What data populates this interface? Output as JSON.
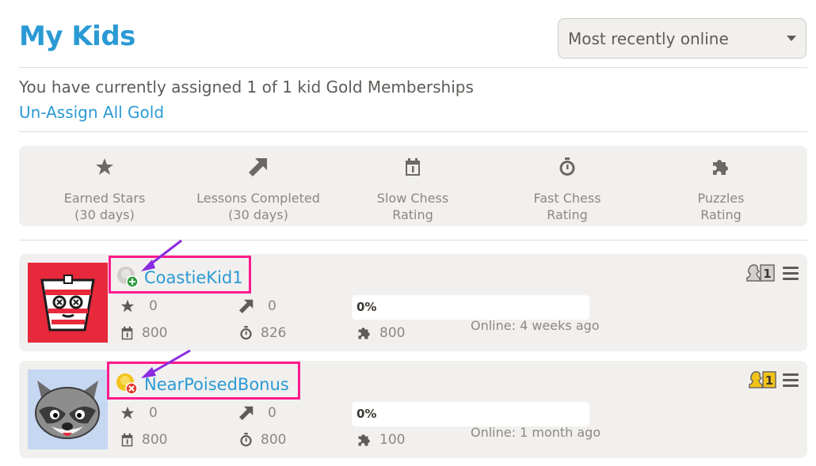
{
  "header": {
    "title": "My Kids",
    "sort_value": "Most recently online"
  },
  "membership": {
    "info": "You have currently assigned 1 of 1 kid Gold Memberships",
    "unassign_label": "Un-Assign All Gold"
  },
  "stats_header": [
    {
      "icon": "star-icon",
      "line1": "Earned Stars",
      "line2": "(30 days)"
    },
    {
      "icon": "arrow-icon",
      "line1": "Lessons Completed",
      "line2": "(30 days)"
    },
    {
      "icon": "calendar-icon",
      "line1": "Slow Chess",
      "line2": "Rating"
    },
    {
      "icon": "stopwatch-icon",
      "line1": "Fast Chess",
      "line2": "Rating"
    },
    {
      "icon": "puzzle-icon",
      "line1": "Puzzles",
      "line2": "Rating"
    }
  ],
  "kids": [
    {
      "name": "CoastieKid1",
      "status": "add",
      "stars": "0",
      "lessons": "0",
      "slow_rating": "800",
      "fast_rating": "826",
      "puzzle_rating": "800",
      "progress": "0%",
      "progress_value": 0,
      "online": "Online: 4 weeks ago",
      "membership_badge": "silver",
      "badge_number": "1"
    },
    {
      "name": "NearPoisedBonus",
      "status": "remove",
      "stars": "0",
      "lessons": "0",
      "slow_rating": "800",
      "fast_rating": "800",
      "puzzle_rating": "100",
      "progress": "0%",
      "progress_value": 0,
      "online": "Online: 1 month ago",
      "membership_badge": "gold",
      "badge_number": "1"
    }
  ],
  "colors": {
    "accent": "#2b9ad4",
    "highlight": "#ff1a8c",
    "annotation_arrow": "#8a2be2",
    "card_bg": "#f1f0ee"
  }
}
